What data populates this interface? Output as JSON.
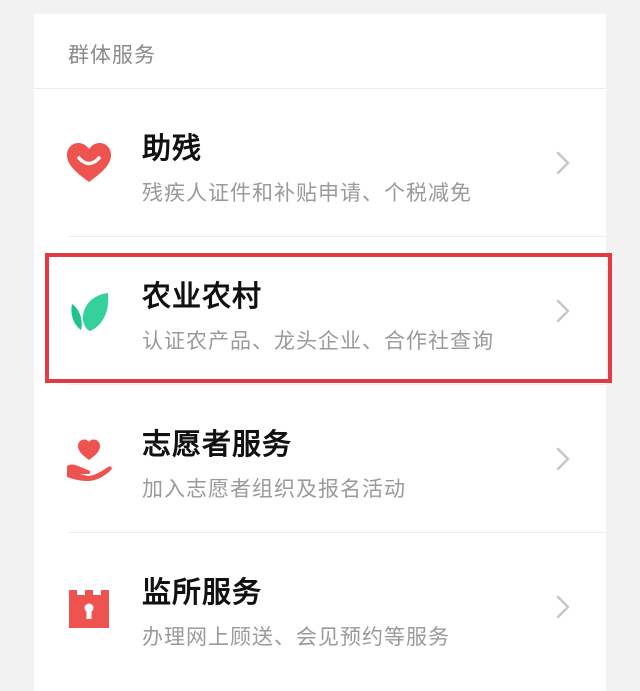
{
  "section": {
    "title": "群体服务"
  },
  "items": [
    {
      "title": "助残",
      "desc": "残疾人证件和补贴申请、个税减免",
      "icon": "heart-smile-icon",
      "icon_color": "#ef5350"
    },
    {
      "title": "农业农村",
      "desc": "认证农产品、龙头企业、合作社查询",
      "icon": "leaf-icon",
      "icon_color": "#1ec28b"
    },
    {
      "title": "志愿者服务",
      "desc": "加入志愿者组织及报名活动",
      "icon": "heart-hand-icon",
      "icon_color": "#ef5350"
    },
    {
      "title": "监所服务",
      "desc": "办理网上顾送、会见预约等服务",
      "icon": "prison-tower-icon",
      "icon_color": "#ef5350"
    }
  ],
  "colors": {
    "highlight_border": "#e23b44",
    "chevron": "#c7c7c7"
  }
}
